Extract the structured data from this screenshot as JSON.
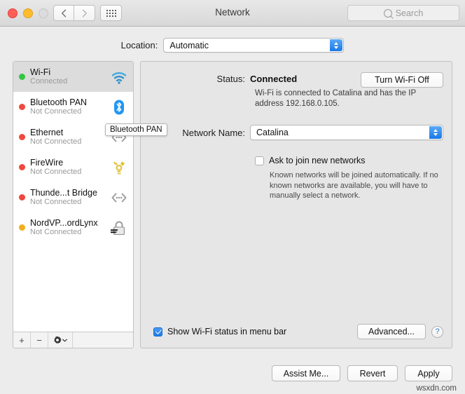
{
  "window": {
    "title": "Network",
    "traffic_lights": [
      "close",
      "minimize",
      "zoom"
    ],
    "nav_back_icon": "chevron-left-icon",
    "nav_forward_icon": "chevron-right-icon",
    "grid_icon": "show-all-icon"
  },
  "search": {
    "placeholder": "Search",
    "icon": "search-icon"
  },
  "location": {
    "label": "Location:",
    "value": "Automatic"
  },
  "sidebar": {
    "interfaces": [
      {
        "name": "Wi-Fi",
        "status": "Connected",
        "dot": "green",
        "icon": "wifi-icon",
        "selected": true
      },
      {
        "name": "Bluetooth PAN",
        "status": "Not Connected",
        "dot": "red",
        "icon": "bluetooth-icon",
        "selected": false
      },
      {
        "name": "Ethernet",
        "status": "Not Connected",
        "dot": "red",
        "icon": "ethernet-icon",
        "selected": false
      },
      {
        "name": "FireWire",
        "status": "Not Connected",
        "dot": "red",
        "icon": "firewire-icon",
        "selected": false
      },
      {
        "name": "Thunde...t Bridge",
        "status": "Not Connected",
        "dot": "red",
        "icon": "thunderbolt-icon",
        "selected": false
      },
      {
        "name": "NordVP...ordLynx",
        "status": "Not Connected",
        "dot": "orange",
        "icon": "lock-icon",
        "selected": false
      }
    ],
    "toolbar": {
      "add_label": "+",
      "remove_label": "−",
      "gear_icon": "gear-icon"
    }
  },
  "tooltip": {
    "text": "Bluetooth PAN"
  },
  "panel": {
    "status_label": "Status:",
    "status_value": "Connected",
    "turn_off_label": "Turn Wi-Fi Off",
    "status_description": "Wi-Fi is connected to Catalina and has the IP address 192.168.0.105.",
    "network_name_label": "Network Name:",
    "network_name_value": "Catalina",
    "ask_join_label": "Ask to join new networks",
    "ask_join_checked": false,
    "ask_join_hint": "Known networks will be joined automatically. If no known networks are available, you will have to manually select a network.",
    "show_status_label": "Show Wi-Fi status in menu bar",
    "show_status_checked": true,
    "advanced_label": "Advanced...",
    "help_label": "?"
  },
  "footer": {
    "assist_label": "Assist Me...",
    "revert_label": "Revert",
    "apply_label": "Apply"
  },
  "watermark": {
    "text": "wsxdn.com"
  },
  "colors": {
    "accent_blue": "#1c7ae8",
    "connected_green": "#33c641",
    "disconnected_red": "#f0483e",
    "warning_orange": "#f3ae1c",
    "window_bg": "#ececec",
    "panel_bg": "#e6e6e6"
  }
}
